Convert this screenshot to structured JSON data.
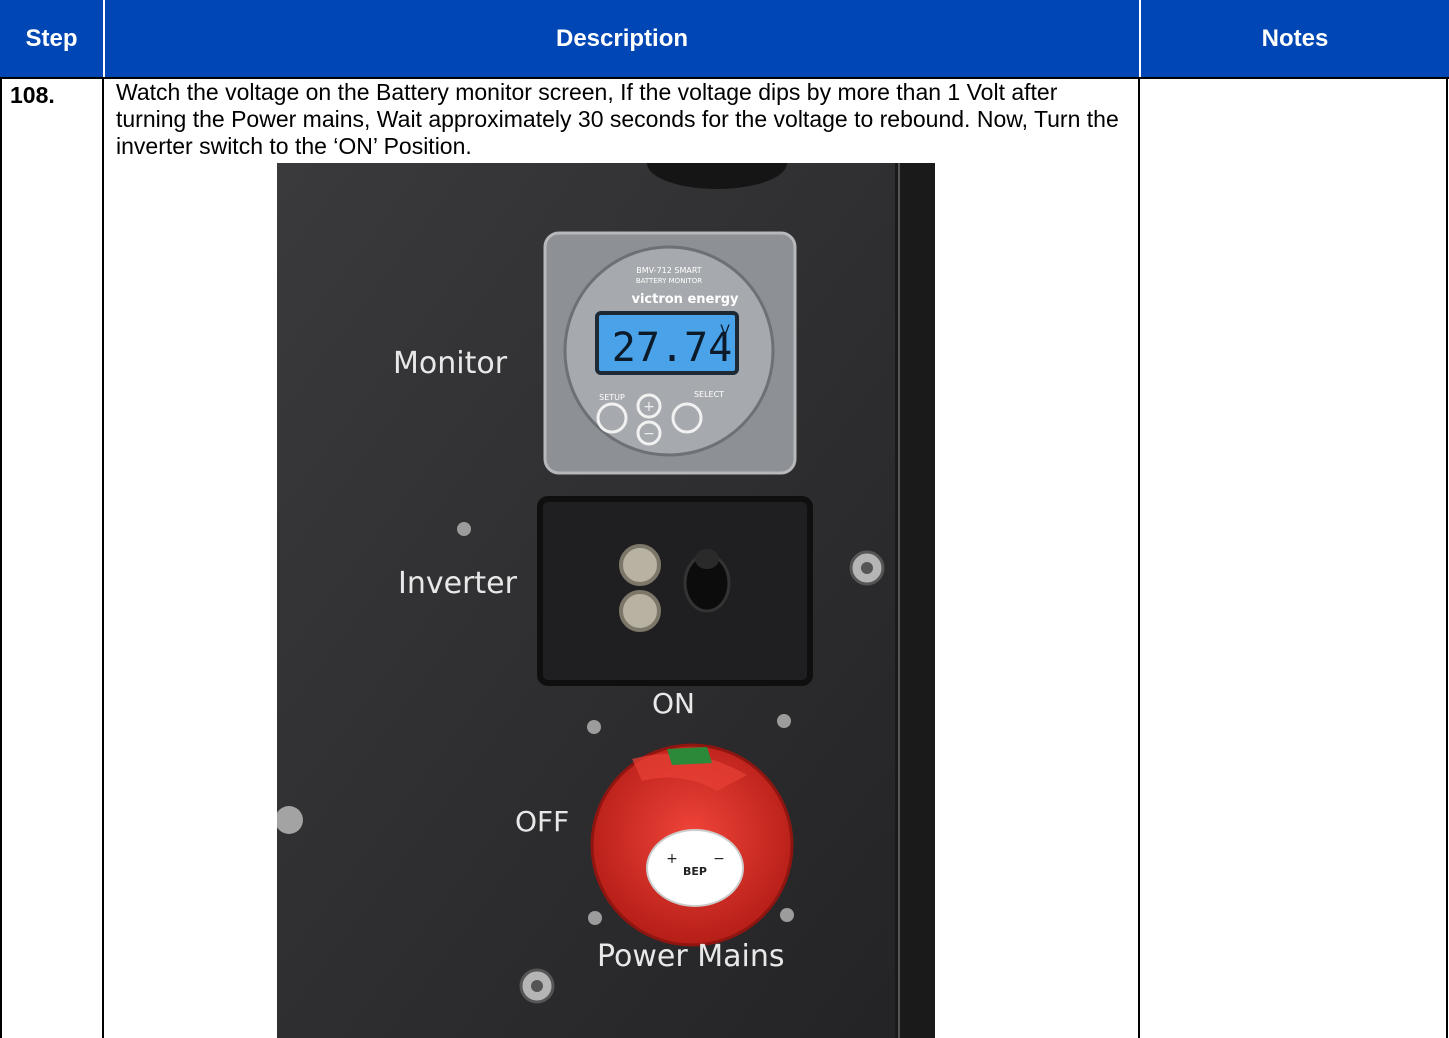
{
  "header": {
    "step": "Step",
    "description": "Description",
    "notes": "Notes"
  },
  "row": {
    "step_number": "108.",
    "description": "Watch the voltage on the Battery monitor screen, If the voltage dips by more than 1 Volt after turning the Power mains, Wait approximately 30 seconds for the voltage to rebound. Now, Turn the inverter switch to the ‘ON’ Position.",
    "notes": ""
  },
  "photo": {
    "monitor_label": "Monitor",
    "inverter_label": "Inverter",
    "on_label": "ON",
    "off_label": "OFF",
    "power_mains_label": "Power Mains",
    "monitor_model": "BMV-712 SMART",
    "monitor_subtitle": "BATTERY MONITOR",
    "monitor_brand": "victron energy",
    "monitor_reading": "27.74",
    "monitor_unit": "V",
    "setup_label": "SETUP",
    "select_label": "SELECT",
    "switch_logo": "BEP"
  },
  "colors": {
    "header_bg": "#0047b5",
    "header_text": "#ffffff",
    "panel": "#2b2b2d",
    "lcd": "#4aa3e8",
    "switch_red": "#d92b22"
  }
}
